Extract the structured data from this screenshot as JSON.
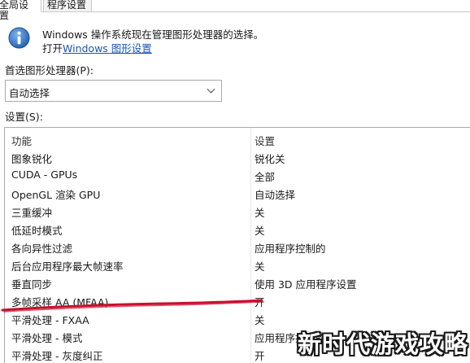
{
  "tabs": [
    {
      "label": "全局设置",
      "active": true
    },
    {
      "label": "程序设置",
      "active": false
    }
  ],
  "info": {
    "icon": "info-icon",
    "line1": "Windows 操作系统现在管理图形处理器的选择。",
    "open_prefix": "打开",
    "link": "Windows 图形设置"
  },
  "preferred_gpu": {
    "label": "首选图形处理器(P):",
    "value": "自动选择"
  },
  "settings": {
    "label": "设置(S):",
    "columns": [
      "功能",
      "设置"
    ],
    "rows": [
      {
        "feature": "图象锐化",
        "value": "锐化关"
      },
      {
        "feature": "CUDA - GPUs",
        "value": "全部"
      },
      {
        "feature": "OpenGL 渲染 GPU",
        "value": "自动选择"
      },
      {
        "feature": "三重缓冲",
        "value": "关"
      },
      {
        "feature": "低延时模式",
        "value": "关"
      },
      {
        "feature": "各向异性过滤",
        "value": "应用程序控制的"
      },
      {
        "feature": "后台应用程序最大帧速率",
        "value": "关"
      },
      {
        "feature": "垂直同步",
        "value": "使用 3D 应用程序设置"
      },
      {
        "feature": "多帧采样 AA (MFAA)",
        "value": "开"
      },
      {
        "feature": "平滑处理 - FXAA",
        "value": "关"
      },
      {
        "feature": "平滑处理 - 模式",
        "value": "应用程序控制的"
      },
      {
        "feature": "平滑处理 - 灰度纠正",
        "value": "开"
      }
    ]
  },
  "annotation_color": "#c8102e",
  "watermark": "新时代游戏攻略"
}
